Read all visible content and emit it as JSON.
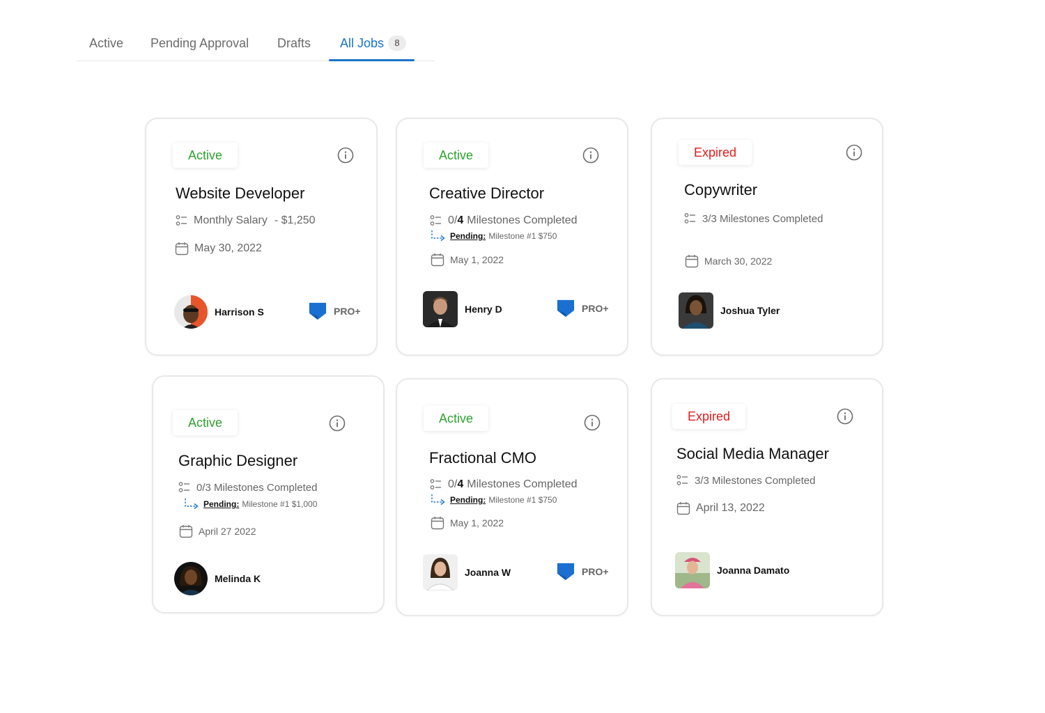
{
  "tabs": [
    {
      "label": "Active"
    },
    {
      "label": "Pending Approval"
    },
    {
      "label": "Drafts"
    },
    {
      "label": "All Jobs",
      "count": "8",
      "selected": true
    }
  ],
  "colors": {
    "accent": "#1a73c7",
    "active": "#2ea12e",
    "expired": "#e01b1b",
    "pro_badge": "#1a6fd1"
  },
  "cards": [
    {
      "status": "Active",
      "title": "Website Developer",
      "salary_label": "Monthly Salary",
      "salary_value": "- $1,250",
      "date": "May 30, 2022",
      "person": "Harrison S",
      "pro": "PRO+"
    },
    {
      "status": "Active",
      "title": "Creative Director",
      "milestones_done": "0/",
      "milestones_total": "4",
      "milestones_label": "Milestones Completed",
      "pending_label": "Pending:",
      "pending_text": "Milestone #1 $750",
      "date": "May 1, 2022",
      "person": "Henry D",
      "pro": "PRO+"
    },
    {
      "status": "Expired",
      "title": "Copywriter",
      "milestones": "3/3 Milestones Completed",
      "date": "March 30, 2022",
      "person": "Joshua Tyler"
    },
    {
      "status": "Active",
      "title": "Graphic Designer",
      "milestones": "0/3 Milestones Completed",
      "pending_label": "Pending:",
      "pending_text": "Milestone #1 $1,000",
      "date": "April 27 2022",
      "person": "Melinda K"
    },
    {
      "status": "Active",
      "title": "Fractional CMO",
      "milestones_done": "0/",
      "milestones_total": "4",
      "milestones_label": "Milestones Completed",
      "pending_label": "Pending:",
      "pending_text": "Milestone #1 $750",
      "date": "May 1, 2022",
      "person": "Joanna W",
      "pro": "PRO+"
    },
    {
      "status": "Expired",
      "title": "Social Media Manager",
      "milestones": "3/3 Milestones Completed",
      "date": "April 13, 2022",
      "person": "Joanna Damato"
    }
  ]
}
